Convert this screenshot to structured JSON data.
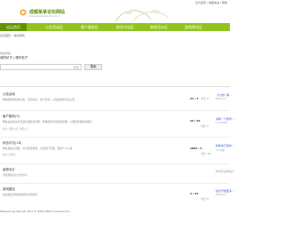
{
  "topbar": {
    "links": "设为首页 | 收藏本站 | 帮助"
  },
  "header": {
    "title": "成都某某论坛网站",
    "subtitle": "www.example-forum.cn"
  },
  "nav": {
    "items": [
      {
        "label": "论坛首页"
      },
      {
        "label": "公告活动区"
      },
      {
        "label": "客户服务区"
      },
      {
        "label": "综合讨论区"
      },
      {
        "label": "装修设计区"
      },
      {
        "label": "游戏建议区"
      }
    ]
  },
  "breadcrumb": {
    "home": "论坛首页",
    "sep": "»",
    "current": "版块导航"
  },
  "sidebar": {
    "caption": "快速导航",
    "mine": "我的帖子 | 精华帖子"
  },
  "search": {
    "placeholder": "搜索",
    "button": "搜索"
  },
  "forums": [
    {
      "title": "公告活动",
      "desc": "网站相关的各类公告、活动信息，热门活动，以及最新的活动公告",
      "mod": "",
      "stat": "24 / 3",
      "stat_sub": "今日: 0",
      "last": "【公告】网...",
      "last_sub": "2016-1-4"
    },
    {
      "title": "客户服务(3)",
      "desc": "网友在此提交意见建议或反馈问题，管理员将及时回复处理，以便提供更好的服务",
      "mod": "版主: 客服小李, 客服小王",
      "stat": "19 / 63",
      "stat_sub": "今日: 0",
      "last": "请教一下账号...",
      "last_sub": "1-1 09:58"
    },
    {
      "title": "综合讨论(18)",
      "desc": "网友自由交流区，分享装修经验、讨论热门话题、发布个人心得",
      "mod": "版主: 管理员",
      "stat": "1806 / 4",
      "stat_sub": "今日: 18",
      "last": "新版本已发布...",
      "last_sub": "4 小时前"
    },
    {
      "title": "装修设计",
      "desc": "家居装修设计交流分享",
      "mod": "",
      "stat": "",
      "stat_sub": "",
      "last": "暂时还没有帖子",
      "last_sub": ""
    },
    {
      "title": "游戏建议",
      "desc": "欢迎提出游戏相关的建议和意见",
      "mod": "",
      "stat": "4 / 23",
      "stat_sub": "今日: 0",
      "last": "建议开放更多...",
      "last_sub": "2015-4-1"
    }
  ],
  "footer": {
    "text": "Powered by Discuz! X3.2 © 2001-2015 Comsenz Inc."
  },
  "colors": {
    "nav_bg": "#8fc31f",
    "nav_active": "#5e9400",
    "logo": "#5a8f00"
  }
}
